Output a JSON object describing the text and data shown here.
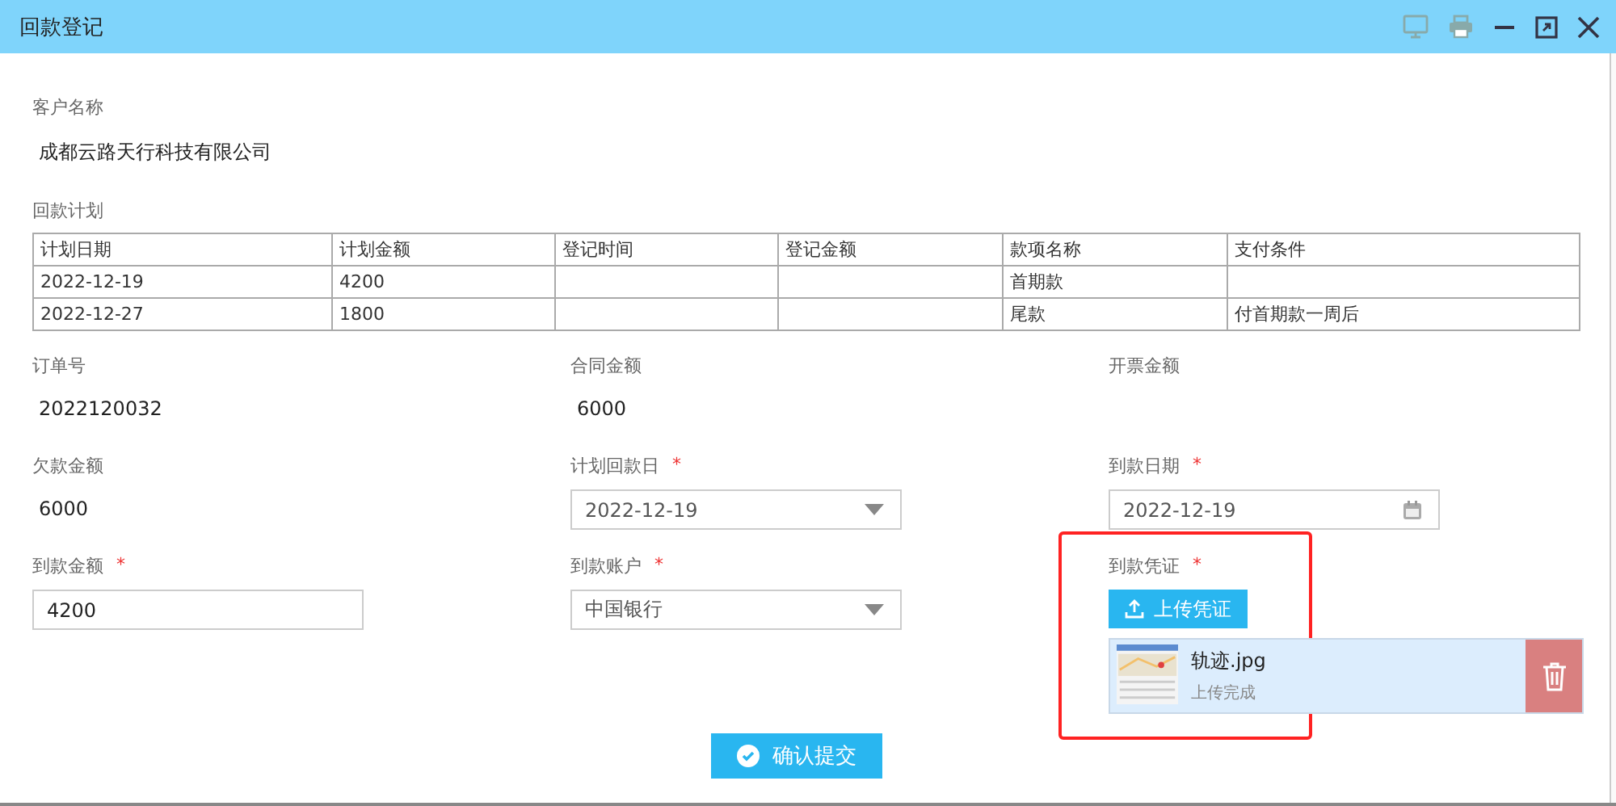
{
  "window": {
    "title": "回款登记"
  },
  "customer": {
    "label": "客户名称",
    "value": "成都云路天行科技有限公司"
  },
  "plan": {
    "label": "回款计划",
    "columns": [
      "计划日期",
      "计划金额",
      "登记时间",
      "登记金额",
      "款项名称",
      "支付条件"
    ],
    "rows": [
      [
        "2022-12-19",
        "4200",
        "",
        "",
        "首期款",
        ""
      ],
      [
        "2022-12-27",
        "1800",
        "",
        "",
        "尾款",
        "付首期款一周后"
      ]
    ]
  },
  "fields": [
    {
      "kind": "static",
      "label": "订单号",
      "value": "2022120032"
    },
    {
      "kind": "static",
      "label": "合同金额",
      "value": "6000"
    },
    {
      "kind": "static",
      "label": "开票金额"
    },
    {
      "kind": "static",
      "label": "欠款金额",
      "value": "6000"
    },
    {
      "kind": "select",
      "label": "计划回款日",
      "mark": "*",
      "value": "2022-12-19"
    },
    {
      "kind": "date",
      "label": "到款日期",
      "mark": "*",
      "value": "2022-12-19"
    },
    {
      "kind": "input",
      "label": "到款金额",
      "mark": "*",
      "value": "4200"
    },
    {
      "kind": "select",
      "label": "到款账户",
      "mark": "*",
      "value": "中国银行"
    },
    {
      "kind": "upload",
      "label": "到款凭证",
      "mark": "*",
      "button": "上传凭证",
      "file": {
        "name": "轨迹.jpg",
        "status": "上传完成"
      }
    }
  ],
  "submit": "确认提交"
}
